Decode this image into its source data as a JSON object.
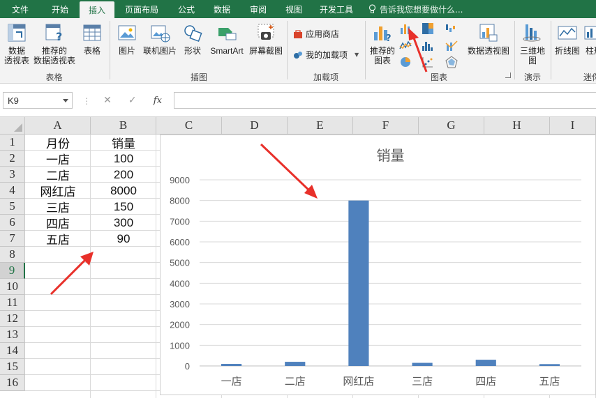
{
  "ribbon": {
    "tabs": [
      "文件",
      "开始",
      "插入",
      "页面布局",
      "公式",
      "数据",
      "审阅",
      "视图",
      "开发工具"
    ],
    "active_tab": "插入",
    "tell_me": "告诉我您想要做什么...",
    "groups": {
      "tables": {
        "label": "表格",
        "buttons": {
          "pivot": "数据\n透视表",
          "recommended_pivot": "推荐的\n数据透视表",
          "table": "表格"
        }
      },
      "illustrations": {
        "label": "插图",
        "buttons": {
          "pictures": "图片",
          "online_pictures": "联机图片",
          "shapes": "形状",
          "smartart": "SmartArt",
          "screenshot": "屏幕截图"
        }
      },
      "addins": {
        "label": "加载项",
        "buttons": {
          "store": "应用商店",
          "my_addins": "我的加载项"
        }
      },
      "charts": {
        "label": "图表",
        "buttons": {
          "recommended_charts": "推荐的\n图表",
          "pivot_chart": "数据透视图"
        }
      },
      "tours": {
        "label": "演示",
        "buttons": {
          "map3d": "三维地\n图"
        }
      },
      "sparklines": {
        "label": "迷你",
        "buttons": {
          "line": "折线图",
          "column": "柱形"
        }
      }
    }
  },
  "formula_bar": {
    "name_box": "K9",
    "cancel": "✕",
    "enter": "✓",
    "fx": "fx",
    "value": ""
  },
  "sheet": {
    "columns": [
      "A",
      "B",
      "C",
      "D",
      "E",
      "F",
      "G",
      "H",
      "I"
    ],
    "rows": [
      "1",
      "2",
      "3",
      "4",
      "5",
      "6",
      "7",
      "8",
      "9",
      "10",
      "11",
      "12",
      "13",
      "14",
      "15",
      "16"
    ],
    "selected_row": "9",
    "cells": {
      "A1": "月份",
      "B1": "销量",
      "A2": "一店",
      "B2": "100",
      "A3": "二店",
      "B3": "200",
      "A4": "网红店",
      "B4": "8000",
      "A5": "三店",
      "B5": "150",
      "A6": "四店",
      "B6": "300",
      "A7": "五店",
      "B7": "90"
    }
  },
  "chart_data": {
    "type": "bar",
    "title": "销量",
    "categories": [
      "一店",
      "二店",
      "网红店",
      "三店",
      "四店",
      "五店"
    ],
    "values": [
      100,
      200,
      8000,
      150,
      300,
      90
    ],
    "ylim": [
      0,
      9000
    ],
    "yticks": [
      0,
      1000,
      2000,
      3000,
      4000,
      5000,
      6000,
      7000,
      8000,
      9000
    ],
    "grid": true,
    "legend": "none",
    "bar_color": "#4f81bd"
  },
  "colors": {
    "ribbon_green": "#217346",
    "annotation_red": "#e8302a"
  }
}
